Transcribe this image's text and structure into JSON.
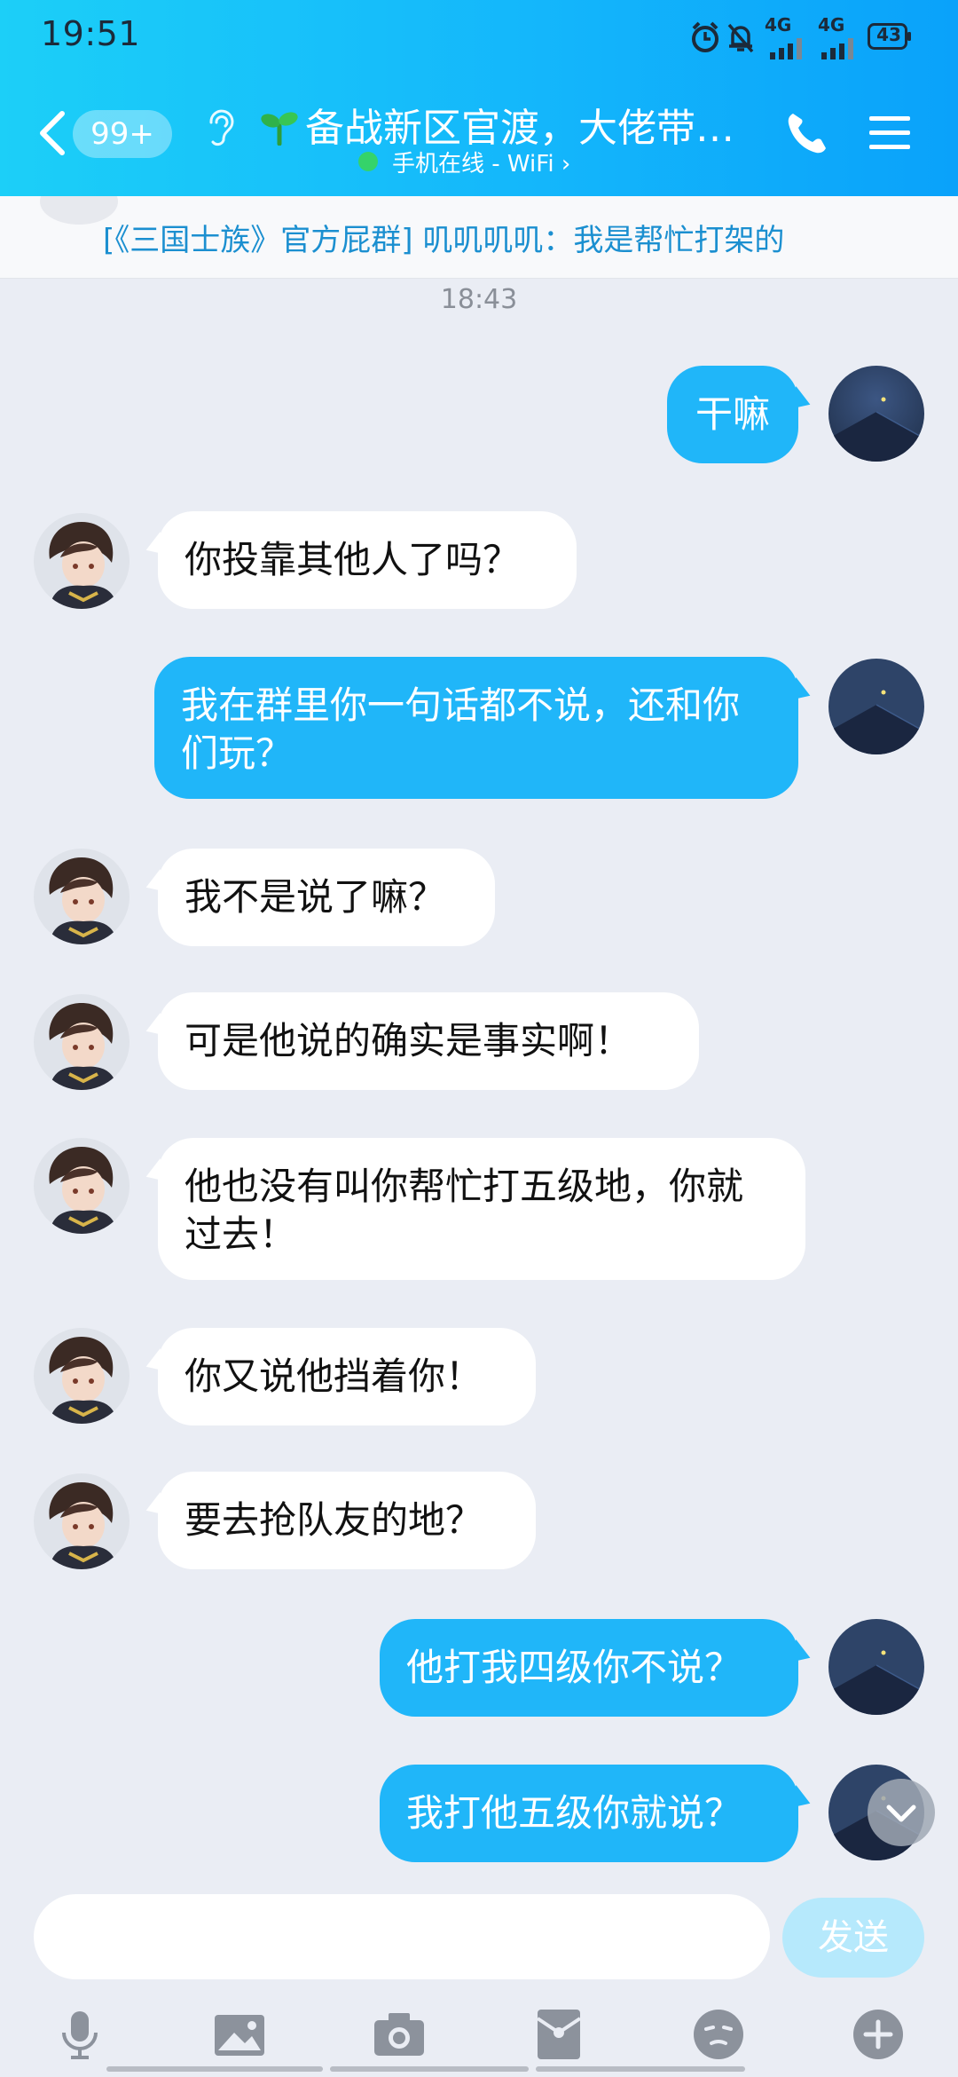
{
  "status_bar": {
    "time": "19:51",
    "network_1": "4G",
    "network_2": "4G",
    "battery": "43"
  },
  "header": {
    "unread_count": "99+",
    "title": "备战新区官渡，大佬带…",
    "subtitle": "手机在线 - WiFi ›"
  },
  "notice": {
    "text": "[《三国士族》官方屁群] 叽叽叽叽：我是帮忙打架的"
  },
  "chat": {
    "timestamp": "18:43",
    "messages": [
      {
        "side": "out",
        "text": "干嘛"
      },
      {
        "side": "in",
        "text": "你投靠其他人了吗？"
      },
      {
        "side": "out",
        "text": "我在群里你一句话都不说，还和你们玩？"
      },
      {
        "side": "in",
        "text": "我不是说了嘛？"
      },
      {
        "side": "in",
        "text": "可是他说的确实是事实啊！"
      },
      {
        "side": "in",
        "text": "他也没有叫你帮忙打五级地，你就过去！"
      },
      {
        "side": "in",
        "text": "你又说他挡着你！"
      },
      {
        "side": "in",
        "text": "要去抢队友的地？"
      },
      {
        "side": "out",
        "text": "他打我四级你不说？"
      },
      {
        "side": "out",
        "text": "我打他五级你就说？"
      }
    ]
  },
  "input": {
    "value": "",
    "placeholder": "",
    "send_label": "发送"
  },
  "toolbar": {
    "items": [
      "microphone-icon",
      "image-icon",
      "camera-icon",
      "red-packet-icon",
      "emoji-icon",
      "plus-icon"
    ]
  },
  "colors": {
    "header_gradient_start": "#1ccff8",
    "header_gradient_end": "#0aa2fa",
    "outgoing_bubble": "#20b6f9",
    "incoming_bubble": "#ffffff",
    "chat_background": "#eaedf4",
    "notice_text": "#1b8fd0",
    "online_dot": "#35d36a",
    "send_button_disabled": "#b6e9fc"
  }
}
